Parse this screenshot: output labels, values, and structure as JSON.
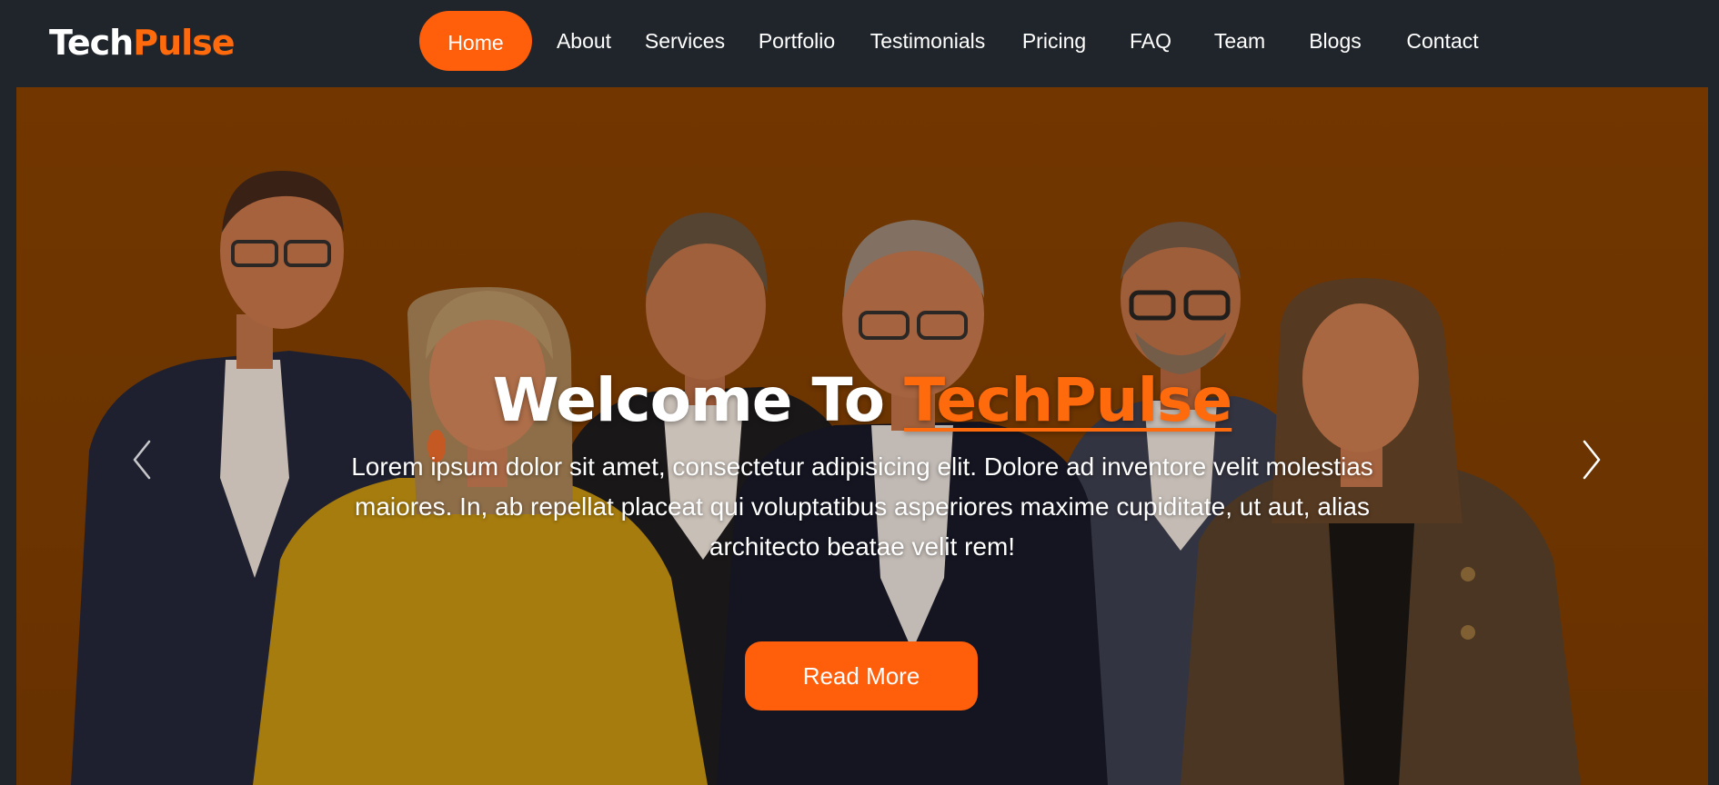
{
  "brand": {
    "part1": "Tech",
    "part2": "Pulse",
    "accent_color": "#ff6a0c"
  },
  "nav": {
    "items": [
      {
        "label": "Home",
        "active": true
      },
      {
        "label": "About"
      },
      {
        "label": "Services"
      },
      {
        "label": "Portfolio"
      },
      {
        "label": "Testimonials"
      },
      {
        "label": "Pricing"
      },
      {
        "label": "FAQ"
      },
      {
        "label": "Team"
      },
      {
        "label": "Blogs"
      },
      {
        "label": "Contact"
      }
    ]
  },
  "hero": {
    "title_prefix": "Welcome To ",
    "title_accent": "TechPulse",
    "description": "Lorem ipsum dolor sit amet, consectetur adipisicing elit. Dolore ad inventore velit molestias maiores. In, ab repellat placeat qui voluptatibus asperiores maxime cupiditate, ut aut, alias architecto beatae velit rem!",
    "button_label": "Read More",
    "prev_icon": "chevron-left-icon",
    "next_icon": "chevron-right-icon"
  },
  "colors": {
    "navbar_bg": "#20252b",
    "accent": "#ff5e0a",
    "hero_bg": "#7c3e00"
  }
}
